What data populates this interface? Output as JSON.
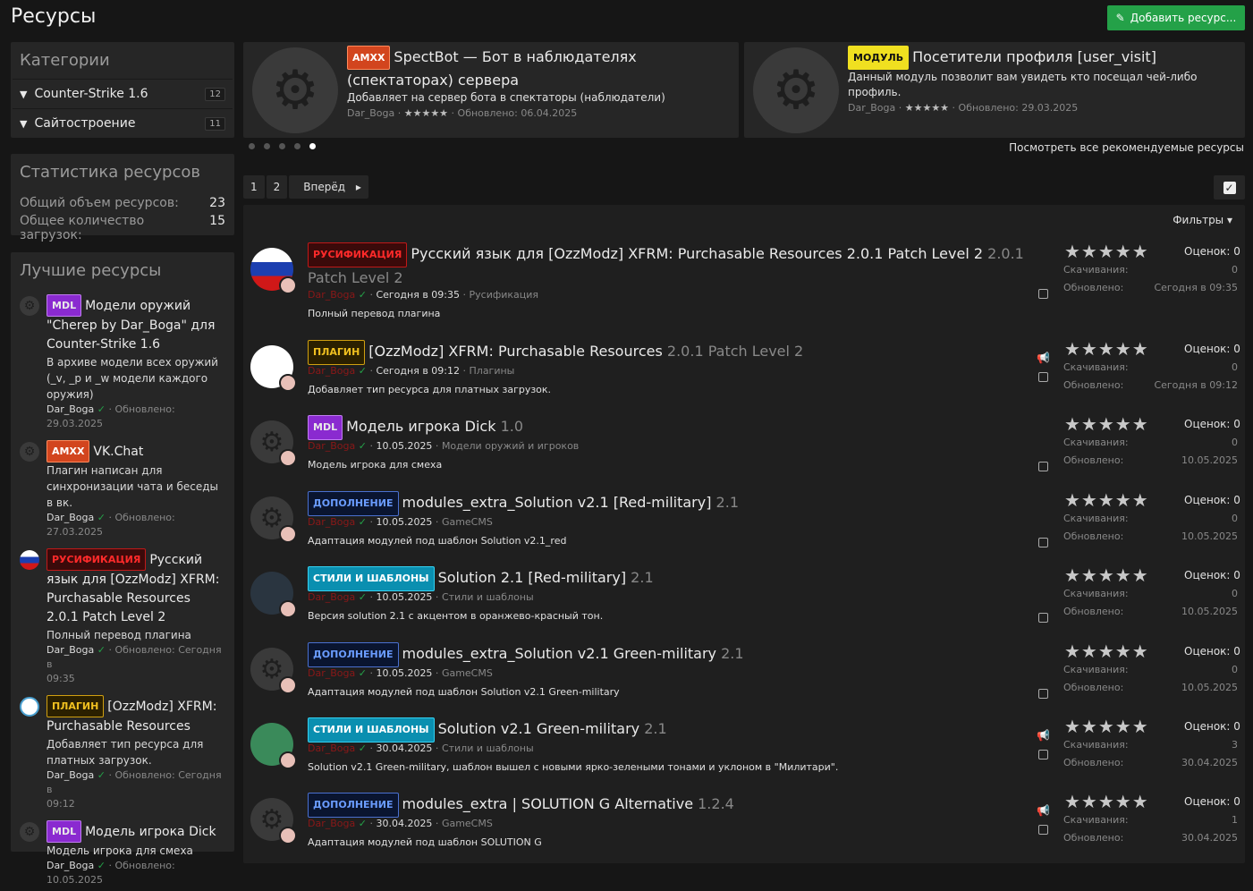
{
  "page_title": "Ресурсы",
  "add_button": "Добавить ресурс...",
  "categories": {
    "title": "Категории",
    "items": [
      {
        "label": "Counter-Strike 1.6",
        "count": "12"
      },
      {
        "label": "Сайтостроение",
        "count": "11"
      }
    ]
  },
  "stats": {
    "title": "Статистика ресурсов",
    "rows": [
      {
        "label": "Общий объем ресурсов:",
        "value": "23"
      },
      {
        "label": "Общее количество загрузок:",
        "value": "15"
      }
    ]
  },
  "best": {
    "title": "Лучшие ресурсы",
    "items": [
      {
        "badge": "MDL",
        "title": "Модели оружий \"Cherep by Dar_Boga\" для Counter-Strike 1.6",
        "desc": "В архиве модели всех оружий (_v, _p и _w модели каждого оружия)",
        "author": "Dar_Boga",
        "updated": "Обновлено:",
        "date": "29.03.2025"
      },
      {
        "badge": "AMXX",
        "title": "VK.Chat",
        "desc": "Плагин написан для синхронизации чата и беседы в вк.",
        "author": "Dar_Boga",
        "updated": "Обновлено:",
        "date": "27.03.2025"
      },
      {
        "badge": "РУСИФИКАЦИЯ",
        "title": "Русский язык для [OzzModz] XFRM: Purchasable Resources 2.0.1 Patch Level 2",
        "desc": "Полный перевод плагина",
        "author": "Dar_Boga",
        "updated": "Обновлено: Сегодня в",
        "date": "09:35"
      },
      {
        "badge": "ПЛАГИН",
        "title": "[OzzModz] XFRM: Purchasable Resources",
        "desc": "Добавляет тип ресурса для платных загрузок.",
        "author": "Dar_Boga",
        "updated": "Обновлено: Сегодня в",
        "date": "09:12"
      },
      {
        "badge": "MDL",
        "title": "Модель игрока Dick",
        "desc": "Модель игрока для смеха",
        "author": "Dar_Boga",
        "updated": "Обновлено:",
        "date": "10.05.2025"
      }
    ]
  },
  "featured": [
    {
      "badge": "AMXX",
      "title": "SpectBot — Бот в наблюдателях (спектаторах) сервера",
      "desc": "Добавляет на сервер бота в спектаторы (наблюдатели)",
      "author": "Dar_Boga",
      "updated": "Обновлено: 06.04.2025"
    },
    {
      "badge": "МОДУЛЬ",
      "title": "Посетители профиля [user_visit]",
      "desc": "Данный модуль позволит вам увидеть кто посещал чей-либо профиль.",
      "author": "Dar_Boga",
      "updated": "Обновлено: 29.03.2025"
    }
  ],
  "view_all": "Посмотреть все рекомендуемые ресурсы",
  "pagination": {
    "p1": "1",
    "p2": "2",
    "next": "Вперёд"
  },
  "filters": "Фильтры",
  "labels": {
    "rating": "Оценок: 0",
    "downloads": "Скачивания:",
    "updated": "Обновлено:"
  },
  "resources": [
    {
      "badge": "РУСИФИКАЦИЯ",
      "title": "Русский язык для [OzzModz] XFRM: Purchasable Resources 2.0.1 Patch Level 2",
      "version": "2.0.1 Patch Level 2",
      "author": "Dar_Boga",
      "date": "Сегодня в 09:35",
      "category": "Русификация",
      "desc": "Полный перевод плагина",
      "downloads": "0",
      "updated": "Сегодня в 09:35"
    },
    {
      "badge": "ПЛАГИН",
      "title": "[OzzModz] XFRM: Purchasable Resources",
      "version": "2.0.1 Patch Level 2",
      "author": "Dar_Boga",
      "date": "Сегодня в 09:12",
      "category": "Плагины",
      "desc": "Добавляет тип ресурса для платных загрузок.",
      "downloads": "0",
      "updated": "Сегодня в 09:12"
    },
    {
      "badge": "MDL",
      "title": "Модель игрока Dick",
      "version": "1.0",
      "author": "Dar_Boga",
      "date": "10.05.2025",
      "category": "Модели оружий и игроков",
      "desc": "Модель игрока для смеха",
      "downloads": "0",
      "updated": "10.05.2025"
    },
    {
      "badge": "ДОПОЛНЕНИЕ",
      "title": "modules_extra_Solution v2.1 [Red-military]",
      "version": "2.1",
      "author": "Dar_Boga",
      "date": "10.05.2025",
      "category": "GameCMS",
      "desc": "Адаптация модулей под шаблон Solution v2.1_red",
      "downloads": "0",
      "updated": "10.05.2025"
    },
    {
      "badge": "СТИЛИ И ШАБЛОНЫ",
      "title": "Solution 2.1 [Red-military]",
      "version": "2.1",
      "author": "Dar_Boga",
      "date": "10.05.2025",
      "category": "Стили и шаблоны",
      "desc": "Версия solution 2.1 с акцентом в оранжево-красный тон.",
      "downloads": "0",
      "updated": "10.05.2025"
    },
    {
      "badge": "ДОПОЛНЕНИЕ",
      "title": "modules_extra_Solution v2.1 Green-military",
      "version": "2.1",
      "author": "Dar_Boga",
      "date": "10.05.2025",
      "category": "GameCMS",
      "desc": "Адаптация модулей под шаблон Solution v2.1 Green-military",
      "downloads": "0",
      "updated": "10.05.2025"
    },
    {
      "badge": "СТИЛИ И ШАБЛОНЫ",
      "title": "Solution v2.1 Green-military",
      "version": "2.1",
      "author": "Dar_Boga",
      "date": "30.04.2025",
      "category": "Стили и шаблоны",
      "desc": "Solution v2.1 Green-military, шаблон вышел с новыми ярко-зелеными тонами и уклоном в \"Милитари\".",
      "downloads": "3",
      "updated": "30.04.2025"
    },
    {
      "badge": "ДОПОЛНЕНИЕ",
      "title": "modules_extra | SOLUTION G Alternative",
      "version": "1.2.4",
      "author": "Dar_Boga",
      "date": "30.04.2025",
      "category": "GameCMS",
      "desc": "Адаптация модулей под шаблон SOLUTION G",
      "downloads": "1",
      "updated": "30.04.2025"
    }
  ],
  "colors": {
    "accent_green": "#24a148",
    "author_red": "#8a1818",
    "panel": "#262626"
  }
}
